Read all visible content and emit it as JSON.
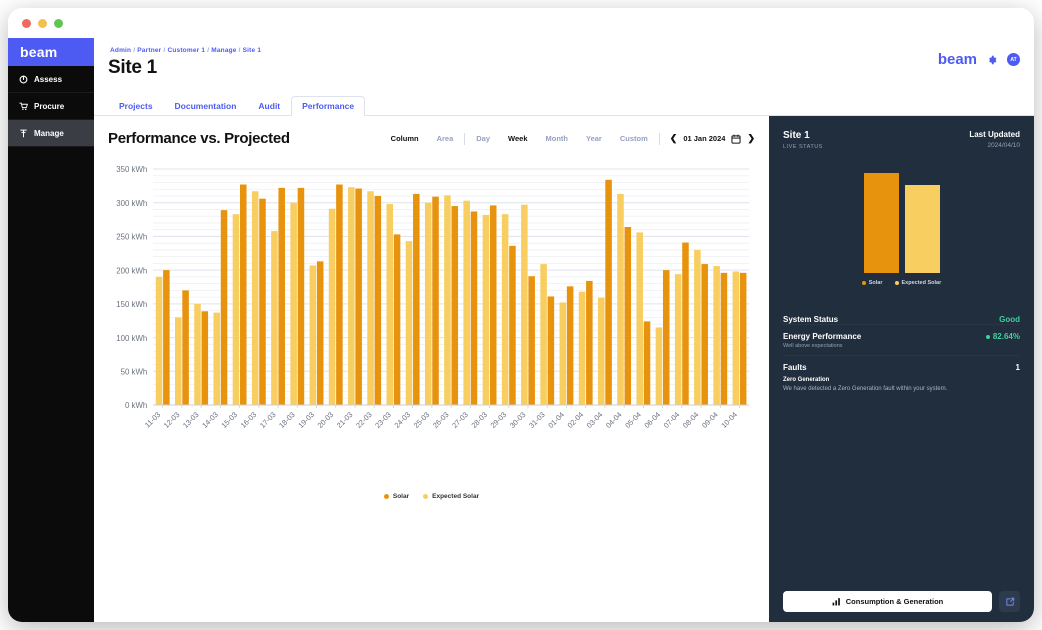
{
  "window": {
    "traffic_lights": [
      "red",
      "yellow",
      "green"
    ]
  },
  "sidebar": {
    "brand": "beam",
    "items": [
      {
        "label": "Assess",
        "icon": "power-icon",
        "active": false
      },
      {
        "label": "Procure",
        "icon": "cart-icon",
        "active": false
      },
      {
        "label": "Manage",
        "icon": "tools-icon",
        "active": true
      }
    ]
  },
  "header": {
    "breadcrumb": [
      "Admin",
      "Partner",
      "Customer 1",
      "Manage",
      "Site 1"
    ],
    "title": "Site 1",
    "logo": "beam",
    "gear_icon": "gear-icon",
    "avatar": "AT"
  },
  "tabs": [
    {
      "label": "Projects",
      "active": false
    },
    {
      "label": "Documentation",
      "active": false
    },
    {
      "label": "Audit",
      "active": false
    },
    {
      "label": "Performance",
      "active": true
    }
  ],
  "toolbar": {
    "title": "Performance vs. Projected",
    "chart_types": [
      {
        "label": "Column",
        "active": true
      },
      {
        "label": "Area",
        "active": false
      }
    ],
    "ranges": [
      {
        "label": "Day",
        "active": false
      },
      {
        "label": "Week",
        "active": true
      },
      {
        "label": "Month",
        "active": false
      },
      {
        "label": "Year",
        "active": false
      },
      {
        "label": "Custom",
        "active": false
      }
    ],
    "prev_icon": "chevron-left-icon",
    "next_icon": "chevron-right-icon",
    "date": "01 Jan 2024",
    "calendar_icon": "calendar-icon"
  },
  "colors": {
    "solar": "#E8930E",
    "expected_solar": "#F8CE60",
    "accent": "#4E5BF2",
    "panel_bg": "#212E3E",
    "green": "#3FD0A0"
  },
  "chart_data": {
    "type": "bar",
    "title": "Performance vs. Projected",
    "xlabel": "",
    "ylabel": "kWh",
    "ylim": [
      0,
      350
    ],
    "yticks": [
      0,
      50,
      100,
      150,
      200,
      250,
      300,
      350
    ],
    "ytick_labels": [
      "0 kWh",
      "50 kWh",
      "100 kWh",
      "150 kWh",
      "200 kWh",
      "250 kWh",
      "300 kWh",
      "350 kWh"
    ],
    "grid": true,
    "legend_position": "bottom",
    "categories": [
      "11-03",
      "12-03",
      "13-03",
      "14-03",
      "15-03",
      "16-03",
      "17-03",
      "18-03",
      "19-03",
      "20-03",
      "21-03",
      "22-03",
      "23-03",
      "24-03",
      "25-03",
      "26-03",
      "27-03",
      "28-03",
      "29-03",
      "30-03",
      "31-03",
      "01-04",
      "02-04",
      "03-04",
      "04-04",
      "05-04",
      "06-04",
      "07-04",
      "08-04",
      "09-04",
      "10-04"
    ],
    "series": [
      {
        "name": "Expected Solar",
        "color": "#F8CE60",
        "values": [
          190,
          130,
          150,
          137,
          283,
          317,
          258,
          300,
          207,
          291,
          323,
          317,
          298,
          243,
          300,
          311,
          303,
          282,
          283,
          297,
          209,
          152,
          168,
          159,
          313,
          256,
          115,
          194,
          230,
          206,
          198
        ]
      },
      {
        "name": "Solar",
        "color": "#E8930E",
        "values": [
          200,
          170,
          139,
          289,
          327,
          306,
          322,
          322,
          213,
          327,
          321,
          310,
          253,
          313,
          309,
          295,
          287,
          296,
          236,
          191,
          161,
          176,
          184,
          334,
          264,
          124,
          200,
          241,
          209,
          196,
          196
        ]
      }
    ]
  },
  "panel": {
    "site": "Site 1",
    "live_status_label": "LIVE STATUS",
    "last_updated_label": "Last Updated",
    "last_updated_value": "2024/04/10",
    "mini_chart": {
      "type": "bar",
      "categories": [
        "Solar",
        "Expected Solar"
      ],
      "values": [
        100,
        88
      ],
      "colors": [
        "#E8930E",
        "#F8CE60"
      ]
    },
    "mini_legend": [
      {
        "label": "Solar",
        "color": "#E8930E"
      },
      {
        "label": "Expected Solar",
        "color": "#F8CE60"
      }
    ],
    "stats": [
      {
        "key": "System Status",
        "value": "Good",
        "green": true,
        "dot": false,
        "note": null
      },
      {
        "key": "Energy Performance",
        "value": "82.64%",
        "green": true,
        "dot": true,
        "note": "Well above expectations"
      },
      {
        "key": "Faults",
        "value": "1",
        "green": false,
        "dot": false,
        "note": null
      }
    ],
    "fault": {
      "title": "Zero Generation",
      "description": "We have detected a Zero Generation fault within your system."
    },
    "footer": {
      "button_label": "Consumption & Generation",
      "button_icon": "bar-chart-icon",
      "external_icon": "external-link-icon"
    }
  }
}
